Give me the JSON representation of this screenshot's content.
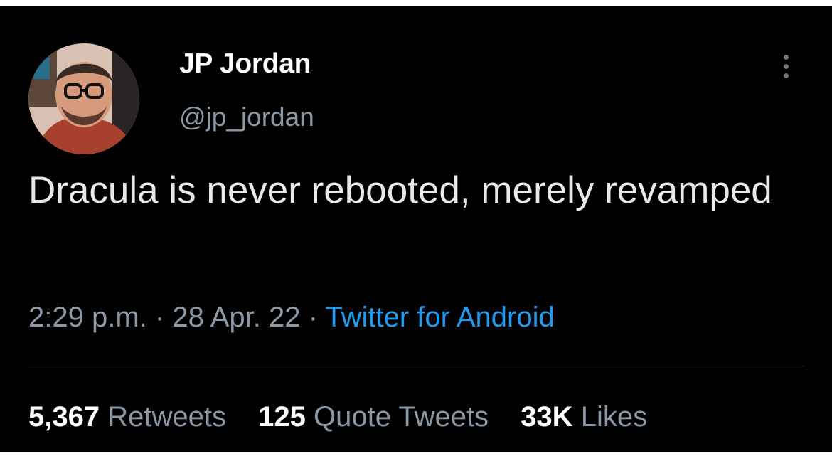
{
  "user": {
    "name": "JP Jordan",
    "handle": "@jp_jordan",
    "avatar_icon": "profile-photo"
  },
  "more_icon": "vertical-ellipsis-icon",
  "tweet": {
    "text": "Dracula is never rebooted, merely revamped",
    "time": "2:29 p.m.",
    "separator": "·",
    "date": "28 Apr. 22",
    "source": "Twitter for Android"
  },
  "stats": {
    "retweets_count": "5,367",
    "retweets_label": "Retweets",
    "quotes_count": "125",
    "quotes_label": "Quote Tweets",
    "likes_count": "33K",
    "likes_label": "Likes"
  },
  "colors": {
    "background": "#000000",
    "text": "#e7e9ea",
    "secondary": "#8b98a5",
    "link": "#1d9bf0"
  }
}
